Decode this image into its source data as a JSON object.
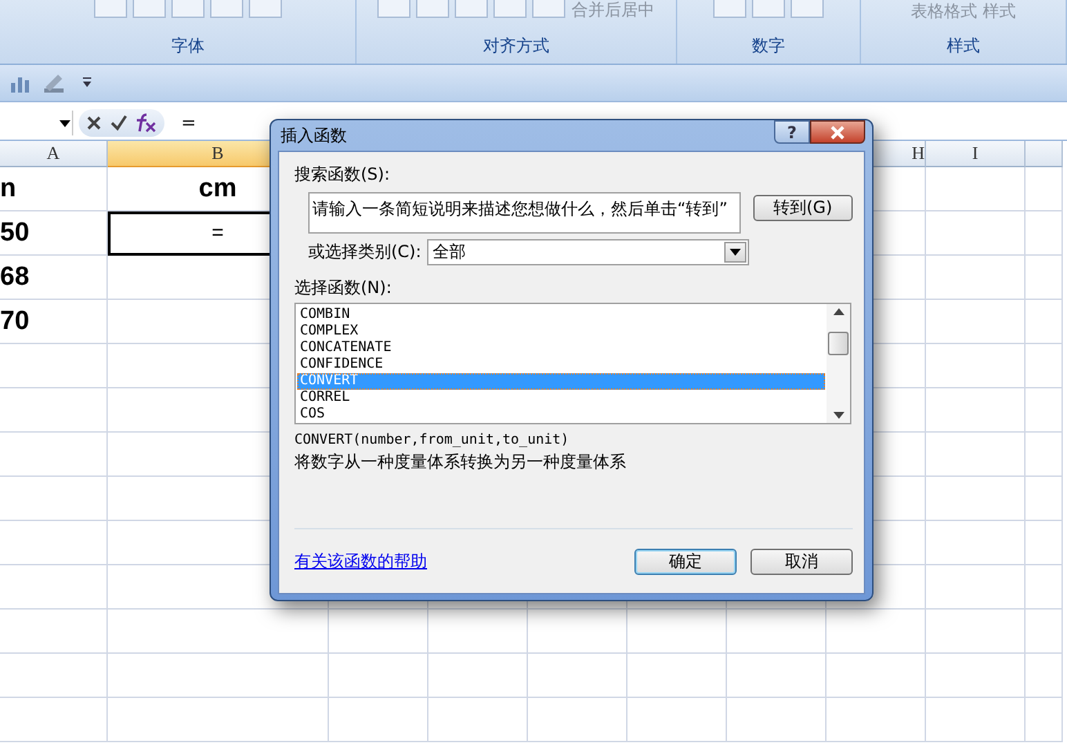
{
  "ribbon": {
    "top_texts": [
      "合并后居中",
      "表格格式",
      "样式"
    ],
    "groups": [
      {
        "label": "字体"
      },
      {
        "label": "对齐方式"
      },
      {
        "label": "数字"
      },
      {
        "label": "样式"
      }
    ]
  },
  "formula_bar": {
    "formula": "="
  },
  "columns": [
    {
      "label": "A",
      "selected": false
    },
    {
      "label": "B",
      "selected": true
    },
    {
      "label": "H",
      "selected": false
    },
    {
      "label": "I",
      "selected": false
    }
  ],
  "rows": [
    {
      "cells": [
        {
          "text": "n",
          "selected": false
        },
        {
          "text": "cm",
          "selected": false
        }
      ]
    },
    {
      "cells": [
        {
          "text": "50",
          "selected": false
        },
        {
          "text": "=",
          "selected": true
        }
      ]
    },
    {
      "cells": [
        {
          "text": "68",
          "selected": false
        },
        {
          "text": "",
          "selected": false
        }
      ]
    },
    {
      "cells": [
        {
          "text": "70",
          "selected": false
        },
        {
          "text": "",
          "selected": false
        }
      ]
    }
  ],
  "dialog": {
    "title": "插入函数",
    "help_button": "?",
    "search_label": "搜索函数(S):",
    "search_value": "请输入一条简短说明来描述您想做什么，然后单击“转到”",
    "go_button": "转到(G)",
    "category_label": "或选择类别(C):",
    "category_value": "全部",
    "function_label": "选择函数(N):",
    "functions": [
      {
        "name": "COMBIN",
        "selected": false
      },
      {
        "name": "COMPLEX",
        "selected": false
      },
      {
        "name": "CONCATENATE",
        "selected": false
      },
      {
        "name": "CONFIDENCE",
        "selected": false
      },
      {
        "name": "CONVERT",
        "selected": true
      },
      {
        "name": "CORREL",
        "selected": false
      },
      {
        "name": "COS",
        "selected": false
      }
    ],
    "signature": "CONVERT(number,from_unit,to_unit)",
    "description": "将数字从一种度量体系转换为另一种度量体系",
    "help_link": "有关该函数的帮助",
    "ok_button": "确定",
    "cancel_button": "取消"
  }
}
